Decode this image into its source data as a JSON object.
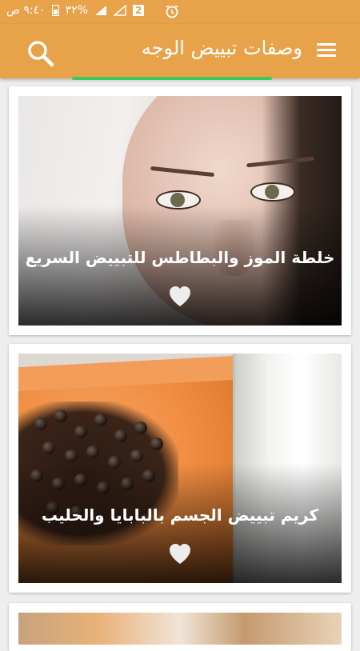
{
  "status_bar": {
    "time": "٩:٤٠ ص",
    "battery": "٣٢%",
    "sim_badge": "2"
  },
  "app_bar": {
    "title": "وصفات تبييض الوجه"
  },
  "progress": 0.55,
  "accent_color": "#e8a34a",
  "progress_color": "#3ec95c",
  "recipes": [
    {
      "title": "خلطة الموز والبطاطس للتبييض السريع",
      "icon": "heart-icon"
    },
    {
      "title": "كريم تبييض الجسم بالبابايا والحليب",
      "icon": "heart-icon"
    }
  ]
}
